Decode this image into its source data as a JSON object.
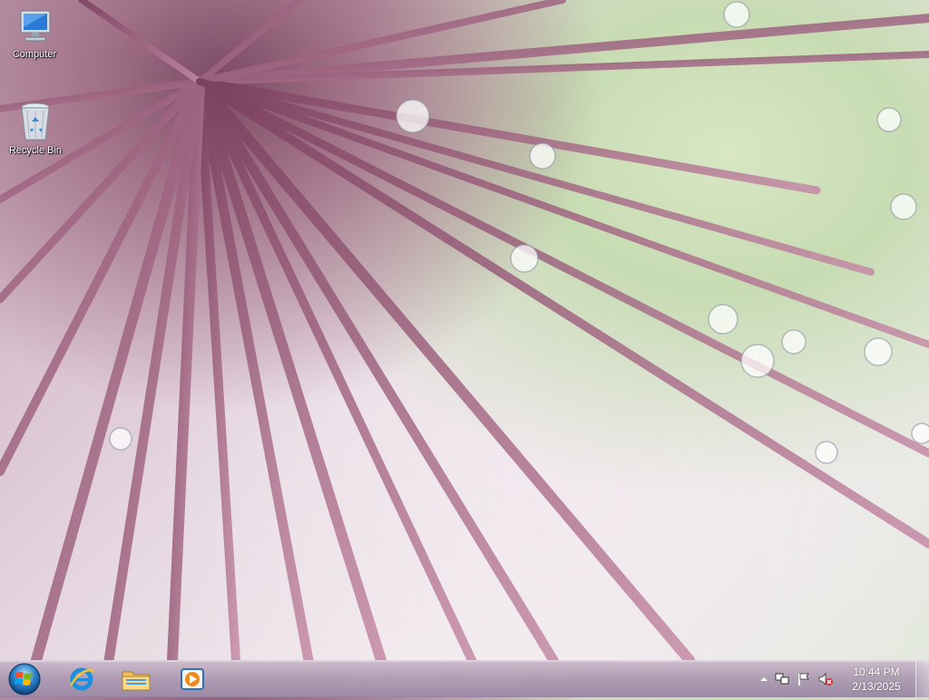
{
  "desktop": {
    "icons": [
      {
        "label": "Computer",
        "icon": "computer-icon"
      },
      {
        "label": "Recycle Bin",
        "icon": "recycle-bin-icon"
      }
    ]
  },
  "taskbar": {
    "start": {
      "icon": "windows-orb-icon"
    },
    "pinned": [
      {
        "icon": "internet-explorer-icon"
      },
      {
        "icon": "file-explorer-icon"
      },
      {
        "icon": "media-player-icon"
      }
    ],
    "tray": {
      "icons": [
        "show-hidden-icons-arrow",
        "network-icon",
        "action-center-flag-icon",
        "volume-muted-icon"
      ],
      "time": "10:44 PM",
      "date": "2/13/2025"
    }
  },
  "colors": {
    "taskbar_tint": "#a896aa",
    "label_text": "#ffffff"
  }
}
